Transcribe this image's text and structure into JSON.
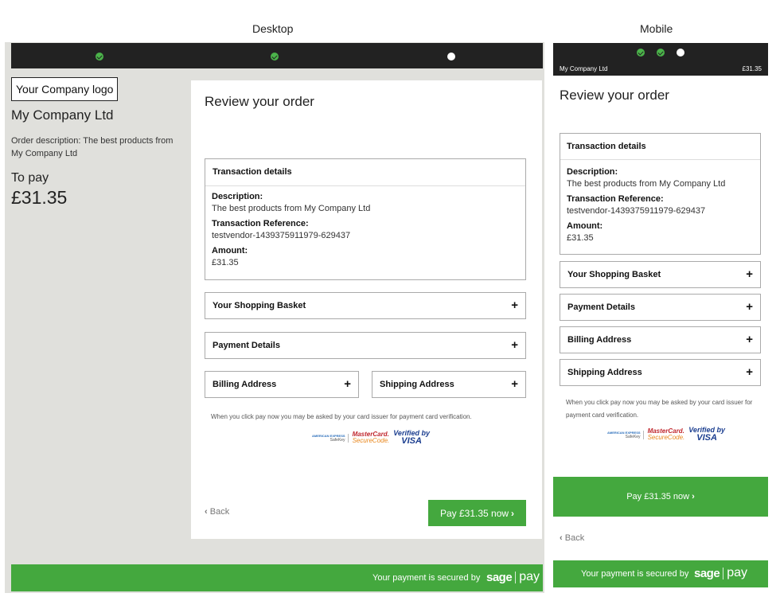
{
  "labels": {
    "desktop": "Desktop",
    "mobile": "Mobile"
  },
  "merchant": {
    "logo_text": "Your Company logo",
    "name": "My Company Ltd",
    "order_description": "Order description: The best products from My Company Ltd",
    "to_pay_label": "To pay",
    "to_pay_amount": "£31.35"
  },
  "progress": {
    "steps_total": 3,
    "steps_completed": 2,
    "current_step": 3
  },
  "review": {
    "title": "Review your order",
    "transaction": {
      "header": "Transaction details",
      "description_label": "Description:",
      "description_value": "The best products from My Company Ltd",
      "reference_label": "Transaction Reference:",
      "reference_value": "testvendor-1439375911979-629437",
      "amount_label": "Amount:",
      "amount_value": "£31.35"
    },
    "sections": {
      "basket": "Your Shopping Basket",
      "payment": "Payment Details",
      "billing": "Billing Address",
      "shipping": "Shipping Address",
      "expand_symbol": "+"
    },
    "notice": "When you click pay now you may be asked by your card issuer for payment card verification.",
    "card_logos": {
      "amex_top": "AMERICAN EXPRESS",
      "amex_bottom": "SafeKey",
      "mastercard_top": "MasterCard.",
      "mastercard_bottom": "SecureCode.",
      "visa_top": "Verified by",
      "visa_bottom": "VISA"
    }
  },
  "actions": {
    "back_label": "Back",
    "back_icon": "‹",
    "pay_label": "Pay £31.35 now",
    "pay_icon": "›"
  },
  "footer": {
    "secured_text": "Your payment is secured by",
    "brand_word": "sage",
    "brand_pay": "pay"
  },
  "mobile": {
    "company": "My Company Ltd",
    "amount": "£31.35"
  },
  "colors": {
    "topbar": "#222222",
    "accent_green": "#44a83e",
    "step_done": "#4bb34a",
    "desktop_bg": "#e0e0dc"
  }
}
